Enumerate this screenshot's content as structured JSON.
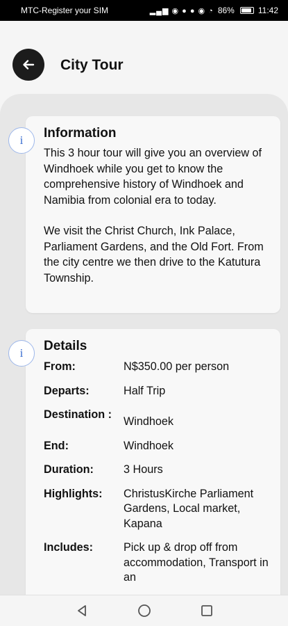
{
  "status_bar": {
    "carrier": "MTC-Register your SIM",
    "battery": "86%",
    "time": "11:42"
  },
  "header": {
    "title": "City Tour"
  },
  "information": {
    "badge": "i",
    "title": "Information",
    "paragraph1": "This 3 hour tour will give you an overview of Windhoek while you get to know the comprehensive history of Windhoek and Namibia from colonial era to today.",
    "paragraph2": "We visit the Christ Church, Ink Palace, Parliament Gardens, and the Old Fort. From the city centre we then drive to the Katutura Township."
  },
  "details": {
    "badge": "i",
    "title": "Details",
    "rows": [
      {
        "key": "From:",
        "value": "N$350.00 per person"
      },
      {
        "key": "Departs:",
        "value": "Half Trip"
      },
      {
        "key": "Destination :",
        "value": "Windhoek"
      },
      {
        "key": "End:",
        "value": "Windhoek"
      },
      {
        "key": "Duration:",
        "value": "3 Hours"
      },
      {
        "key": "Highlights:",
        "value": "ChristusKirche Parliament Gardens, Local market, Kapana"
      },
      {
        "key": "Includes:",
        "value": "Pick up & drop off from accommodation, Transport in an"
      }
    ]
  },
  "nav": {
    "back_icon": "triangle-back-icon",
    "home_icon": "circle-home-icon",
    "recents_icon": "square-recents-icon"
  }
}
